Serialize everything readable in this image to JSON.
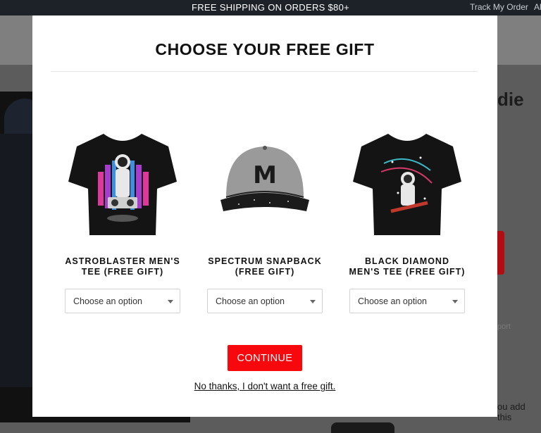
{
  "topbar": {
    "promo": "FREE SHIPPING ON ORDERS $80+",
    "track_order": "Track My Order",
    "cut_link": "Al"
  },
  "background": {
    "product_title_fragment": "die",
    "report_fragment": "port",
    "add_fragment": "ou add this"
  },
  "modal": {
    "title": "CHOOSE YOUR FREE GIFT",
    "gifts": [
      {
        "name": "ASTROBLASTER MEN'S\nTEE (FREE GIFT)",
        "select_value": "Choose an option",
        "icon": "astronaut-boombox-tshirt-icon"
      },
      {
        "name": "SPECTRUM SNAPBACK\n(FREE GIFT)",
        "select_value": "Choose an option",
        "icon": "snapback-cap-icon"
      },
      {
        "name": "BLACK DIAMOND\nMEN'S TEE (FREE GIFT)",
        "select_value": "Choose an option",
        "icon": "astronaut-space-tshirt-icon"
      }
    ],
    "continue_label": "CONTINUE",
    "decline_label": "No thanks, I don't want a free gift."
  },
  "colors": {
    "topbar_bg": "#1d2128",
    "continue_bg": "#f6080c",
    "overlay": "#5c5c5c"
  }
}
